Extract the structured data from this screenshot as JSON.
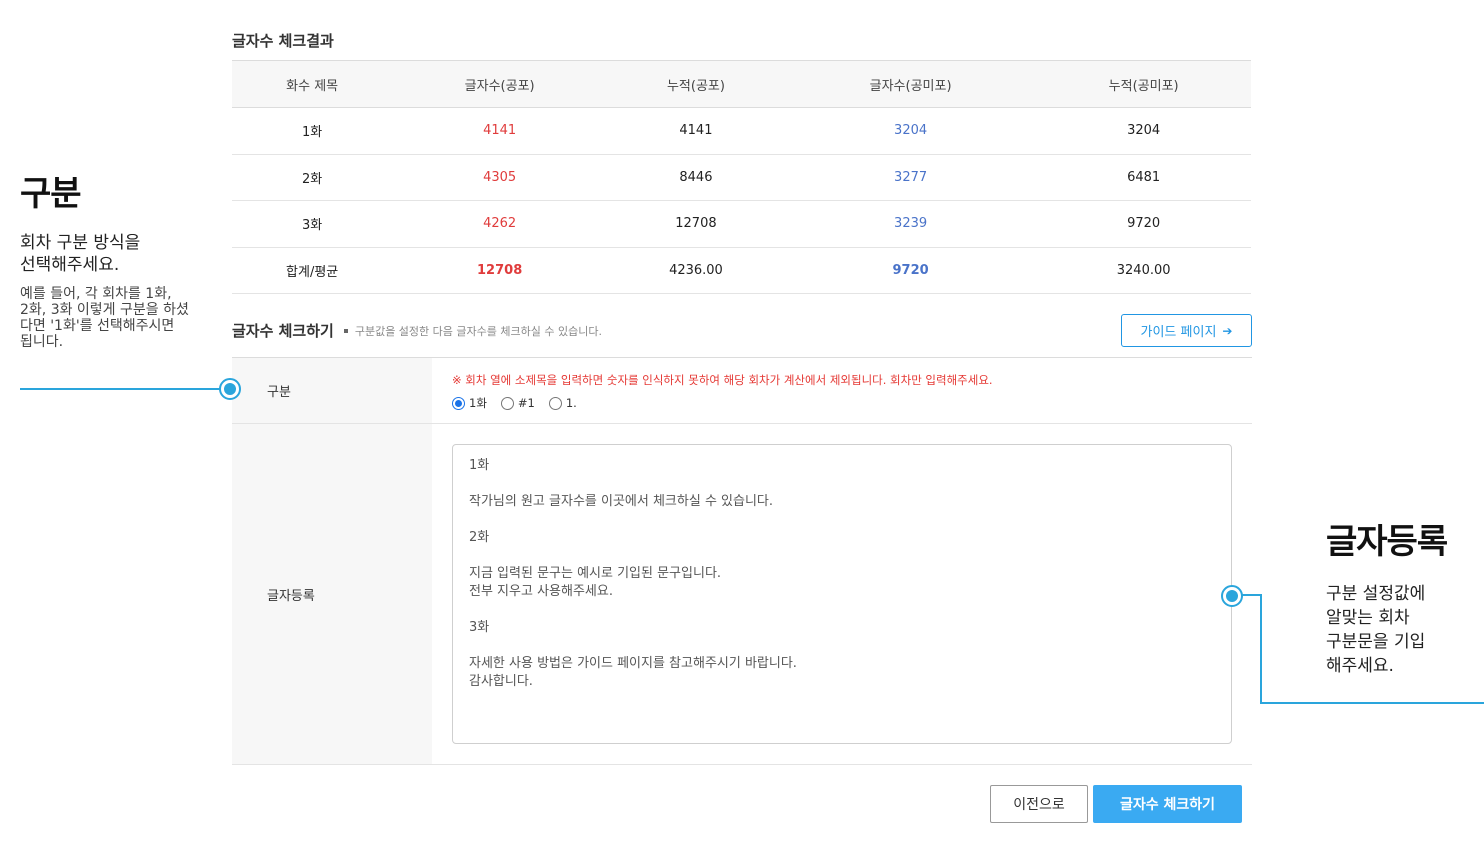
{
  "result": {
    "title": "글자수 체크결과",
    "headers": [
      "화수 제목",
      "글자수(공포)",
      "누적(공포)",
      "글자수(공미포)",
      "누적(공미포)"
    ],
    "rows": [
      [
        "1화",
        "4141",
        "4141",
        "3204",
        "3204"
      ],
      [
        "2화",
        "4305",
        "8446",
        "3277",
        "6481"
      ],
      [
        "3화",
        "4262",
        "12708",
        "3239",
        "9720"
      ]
    ],
    "total": [
      "합계/평균",
      "12708",
      "4236.00",
      "9720",
      "3240.00"
    ]
  },
  "check": {
    "title": "글자수 체크하기",
    "desc": "구분값을 설정한 다음 글자수를 체크하실 수 있습니다.",
    "guide_label": "가이드 페이지"
  },
  "form": {
    "division_label": "구분",
    "warning": "※ 회차 열에 소제목을 입력하면 숫자를 인식하지 못하여 해당 회차가 계산에서 제외됩니다. 회차만 입력해주세요.",
    "options": [
      "1화",
      "#1",
      "1."
    ],
    "selected_option": "1화",
    "register_label": "글자등록",
    "text_lines": [
      "1화",
      "",
      "작가님의 원고 글자수를 이곳에서 체크하실 수 있습니다.",
      "",
      "2화",
      "",
      "지금 입력된 문구는 예시로 기입된 문구입니다.",
      "전부 지우고 사용해주세요.",
      "",
      "3화",
      "",
      "자세한 사용 방법은 가이드 페이지를 참고해주시기 바랍니다.",
      "감사합니다."
    ]
  },
  "buttons": {
    "prev": "이전으로",
    "submit": "글자수 체크하기"
  },
  "annotations": {
    "left": {
      "title": "구분",
      "sub_lines": [
        "회차 구분 방식을",
        "선택해주세요."
      ],
      "small_lines": [
        "예를 들어, 각 회차를 1화,",
        "2화, 3화 이렇게 구분을 하셨",
        "다면 '1화'를 선택해주시면",
        "됩니다."
      ]
    },
    "right": {
      "title": "글자등록",
      "sub_lines": [
        "구분 설정값에",
        "알맞는 회차",
        "구분문을 기입",
        "해주세요."
      ]
    }
  },
  "colors": {
    "accent": "#3aaaf2",
    "guide": "#2196e3",
    "warning": "#e53935",
    "count_red": "#e03c3c",
    "count_blue": "#4a73c9",
    "annotation": "#2aa5dc"
  }
}
